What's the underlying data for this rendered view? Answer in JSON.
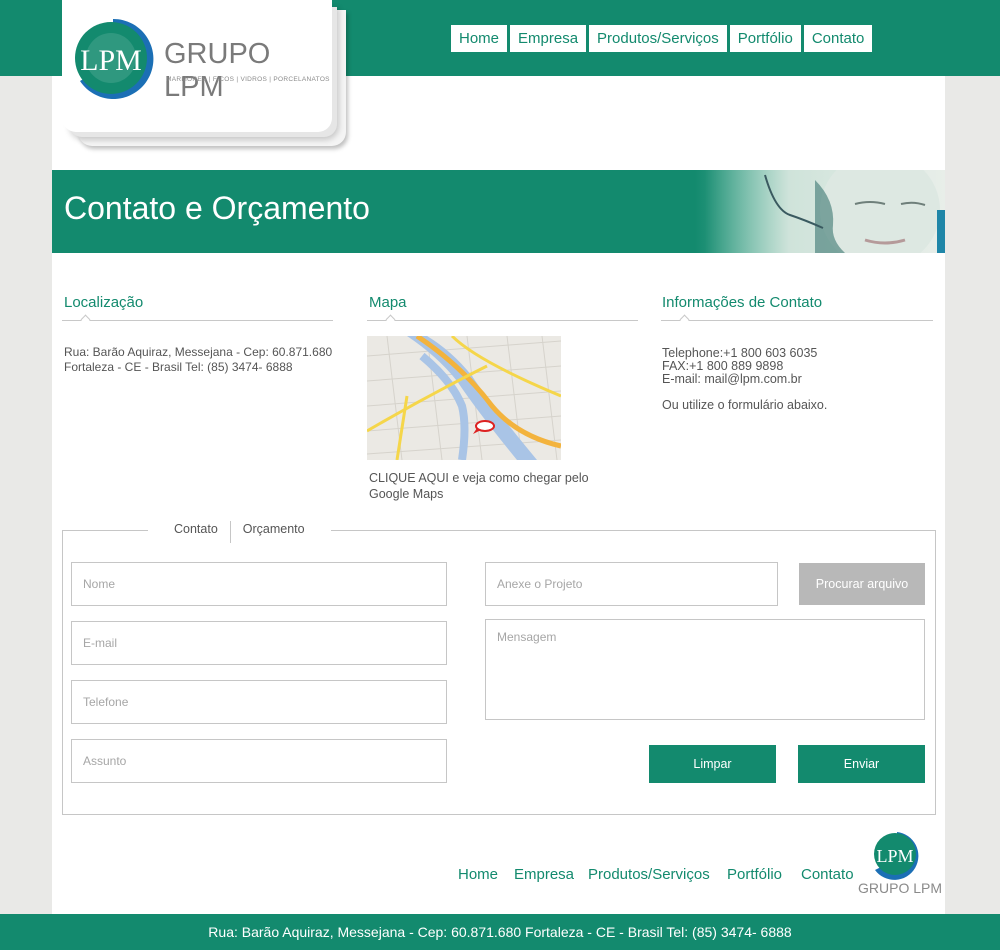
{
  "brand": {
    "logo_initials": "LPM",
    "name": "GRUPO LPM",
    "tagline": "MARMORES | FICOS | VIDROS | PORCELANATOS",
    "colors": {
      "primary": "#138a6e",
      "logo_blue": "#1b6fb5"
    }
  },
  "nav": [
    "Home",
    "Empresa",
    "Produtos/Serviços",
    "Portfólio",
    "Contato"
  ],
  "banner": {
    "title": "Contato e Orçamento"
  },
  "location": {
    "heading": "Localização",
    "line1": "Rua: Barão Aquiraz, Messejana - Cep: 60.871.680",
    "line2": "Fortaleza - CE - Brasil Tel: (85) 3474- 6888"
  },
  "map": {
    "heading": "Mapa",
    "link_text": "CLIQUE AQUI e veja como chegar pelo Google Maps"
  },
  "contact_info": {
    "heading": "Informações de Contato",
    "telephone": "Telephone:+1 800 603 6035",
    "fax": "FAX:+1 800 889 9898",
    "email": "E-mail: mail@lpm.com.br",
    "alt": "Ou utilize o formulário abaixo."
  },
  "form": {
    "tabs": [
      "Contato",
      "Orçamento"
    ],
    "placeholders": {
      "name": "Nome",
      "email": "E-mail",
      "phone": "Telefone",
      "subject": "Assunto",
      "attachment": "Anexe o Projeto",
      "message": "Mensagem"
    },
    "browse_button": "Procurar arquivo",
    "clear_button": "Limpar",
    "submit_button": "Enviar"
  },
  "footer": {
    "nav": [
      "Home",
      "Empresa",
      "Produtos/Serviços",
      "Portfólio",
      "Contato"
    ],
    "logo_text": "GRUPO LPM",
    "address": "Rua: Barão Aquiraz, Messejana - Cep: 60.871.680 Fortaleza - CE - Brasil Tel: (85) 3474- 6888"
  }
}
